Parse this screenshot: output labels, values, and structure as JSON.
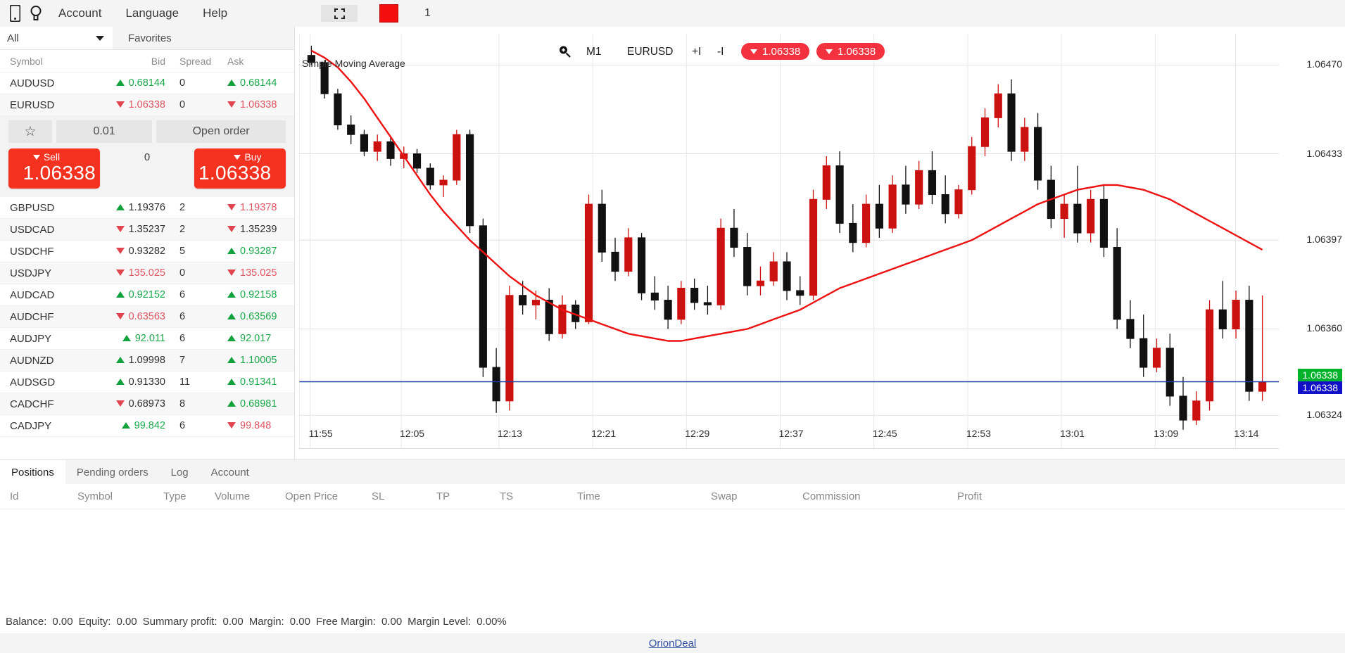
{
  "menu": {
    "icons": [
      {
        "name": "mobile-icon",
        "glyph": "▯"
      },
      {
        "name": "bulb-icon",
        "glyph": "◌"
      }
    ],
    "items": [
      {
        "label": "Account"
      },
      {
        "label": "Language"
      },
      {
        "label": "Help"
      }
    ]
  },
  "watchlist": {
    "filter_value": "All",
    "favorites_label": "Favorites",
    "columns": [
      "Symbol",
      "Bid",
      "Spread",
      "Ask"
    ],
    "rows": [
      {
        "symbol": "AUDUSD",
        "bid": "0.68144",
        "bid_dir": "up",
        "bid_color": "green",
        "spread": "0",
        "ask": "0.68144",
        "ask_dir": "up",
        "ask_color": "green"
      },
      {
        "symbol": "EURUSD",
        "bid": "1.06338",
        "bid_dir": "down",
        "bid_color": "red",
        "spread": "0",
        "ask": "1.06338",
        "ask_dir": "down",
        "ask_color": "red"
      },
      {
        "symbol": "GBPUSD",
        "bid": "1.19376",
        "bid_dir": "up",
        "bid_color": "dark",
        "spread": "2",
        "ask": "1.19378",
        "ask_dir": "down",
        "ask_color": "red"
      },
      {
        "symbol": "USDCAD",
        "bid": "1.35237",
        "bid_dir": "down",
        "bid_color": "dark",
        "spread": "2",
        "ask": "1.35239",
        "ask_dir": "down",
        "ask_color": "dark"
      },
      {
        "symbol": "USDCHF",
        "bid": "0.93282",
        "bid_dir": "down",
        "bid_color": "dark",
        "spread": "5",
        "ask": "0.93287",
        "ask_dir": "up",
        "ask_color": "green"
      },
      {
        "symbol": "USDJPY",
        "bid": "135.025",
        "bid_dir": "down",
        "bid_color": "red",
        "spread": "0",
        "ask": "135.025",
        "ask_dir": "down",
        "ask_color": "red"
      },
      {
        "symbol": "AUDCAD",
        "bid": "0.92152",
        "bid_dir": "up",
        "bid_color": "green",
        "spread": "6",
        "ask": "0.92158",
        "ask_dir": "up",
        "ask_color": "green"
      },
      {
        "symbol": "AUDCHF",
        "bid": "0.63563",
        "bid_dir": "down",
        "bid_color": "red",
        "spread": "6",
        "ask": "0.63569",
        "ask_dir": "up",
        "ask_color": "green"
      },
      {
        "symbol": "AUDJPY",
        "bid": "92.011",
        "bid_dir": "up",
        "bid_color": "green",
        "spread": "6",
        "ask": "92.017",
        "ask_dir": "up",
        "ask_color": "green"
      },
      {
        "symbol": "AUDNZD",
        "bid": "1.09998",
        "bid_dir": "up",
        "bid_color": "dark",
        "spread": "7",
        "ask": "1.10005",
        "ask_dir": "up",
        "ask_color": "green"
      },
      {
        "symbol": "AUDSGD",
        "bid": "0.91330",
        "bid_dir": "up",
        "bid_color": "dark",
        "spread": "11",
        "ask": "0.91341",
        "ask_dir": "up",
        "ask_color": "green"
      },
      {
        "symbol": "CADCHF",
        "bid": "0.68973",
        "bid_dir": "down",
        "bid_color": "dark",
        "spread": "8",
        "ask": "0.68981",
        "ask_dir": "up",
        "ask_color": "green"
      },
      {
        "symbol": "CADJPY",
        "bid": "99.842",
        "bid_dir": "up",
        "bid_color": "green",
        "spread": "6",
        "ask": "99.848",
        "ask_dir": "down",
        "ask_color": "red"
      }
    ],
    "order_panel": {
      "star_icon": "star-icon",
      "volume": "0.01",
      "open_order_label": "Open order",
      "sell_label": "Sell",
      "sell_price": "1.06338",
      "buy_label": "Buy",
      "buy_price": "1.06338",
      "spread": "0"
    }
  },
  "chart_toolbar": {
    "expand_icon": "fullscreen-icon",
    "color_swatch": "#f40e0e",
    "number": "1"
  },
  "chart_header": {
    "zoom_icon": "zoom-in-icon",
    "timeframe": "M1",
    "symbol": "EURUSD",
    "zoom_in_label": "+I",
    "zoom_out_label": "-I",
    "badge_bid": "1.06338",
    "badge_ask": "1.06338",
    "indicator_label": "Simple Moving Average"
  },
  "chart_data": {
    "type": "candlestick",
    "title": "EURUSD M1",
    "indicator": "Simple Moving Average",
    "indicator_color": "#ee1111",
    "up_color": "#111111",
    "down_color": "#cc1111",
    "grid": true,
    "ylabel": "",
    "xlabel": "",
    "ylim": [
      1.0631,
      1.06483
    ],
    "y_ticks": [
      "1.06470",
      "1.06433",
      "1.06397",
      "1.06360",
      "1.06324"
    ],
    "y_tick_values": [
      1.0647,
      1.06433,
      1.06397,
      1.0636,
      1.06324
    ],
    "current_price": "1.06338",
    "price_tag_bid": "1.06338",
    "price_tag_ask": "1.06338",
    "x_ticks": [
      "11:55",
      "12:05",
      "12:13",
      "12:21",
      "12:29",
      "12:37",
      "12:45",
      "12:53",
      "13:01",
      "13:09",
      "13:14"
    ],
    "candles": [
      {
        "o": 1.06474,
        "h": 1.06478,
        "l": 1.0647,
        "c": 1.06471,
        "dir": "down"
      },
      {
        "o": 1.06471,
        "h": 1.06472,
        "l": 1.06456,
        "c": 1.06458,
        "dir": "down"
      },
      {
        "o": 1.06458,
        "h": 1.0646,
        "l": 1.06443,
        "c": 1.06445,
        "dir": "down"
      },
      {
        "o": 1.06445,
        "h": 1.06449,
        "l": 1.06437,
        "c": 1.06441,
        "dir": "down"
      },
      {
        "o": 1.06441,
        "h": 1.06443,
        "l": 1.06432,
        "c": 1.06434,
        "dir": "down"
      },
      {
        "o": 1.06434,
        "h": 1.06441,
        "l": 1.0643,
        "c": 1.06438,
        "dir": "up"
      },
      {
        "o": 1.06438,
        "h": 1.0644,
        "l": 1.06428,
        "c": 1.06431,
        "dir": "down"
      },
      {
        "o": 1.06431,
        "h": 1.06436,
        "l": 1.06427,
        "c": 1.06433,
        "dir": "up"
      },
      {
        "o": 1.06433,
        "h": 1.06435,
        "l": 1.06425,
        "c": 1.06427,
        "dir": "down"
      },
      {
        "o": 1.06427,
        "h": 1.06429,
        "l": 1.06418,
        "c": 1.0642,
        "dir": "down"
      },
      {
        "o": 1.0642,
        "h": 1.06424,
        "l": 1.06415,
        "c": 1.06422,
        "dir": "up"
      },
      {
        "o": 1.06422,
        "h": 1.06443,
        "l": 1.0642,
        "c": 1.06441,
        "dir": "up"
      },
      {
        "o": 1.06441,
        "h": 1.06443,
        "l": 1.064,
        "c": 1.06403,
        "dir": "down"
      },
      {
        "o": 1.06403,
        "h": 1.06406,
        "l": 1.0634,
        "c": 1.06344,
        "dir": "down"
      },
      {
        "o": 1.06344,
        "h": 1.06352,
        "l": 1.06325,
        "c": 1.0633,
        "dir": "down"
      },
      {
        "o": 1.0633,
        "h": 1.06378,
        "l": 1.06326,
        "c": 1.06374,
        "dir": "up"
      },
      {
        "o": 1.06374,
        "h": 1.0638,
        "l": 1.06366,
        "c": 1.0637,
        "dir": "down"
      },
      {
        "o": 1.0637,
        "h": 1.06376,
        "l": 1.06364,
        "c": 1.06372,
        "dir": "up"
      },
      {
        "o": 1.06372,
        "h": 1.06377,
        "l": 1.06355,
        "c": 1.06358,
        "dir": "down"
      },
      {
        "o": 1.06358,
        "h": 1.06374,
        "l": 1.06356,
        "c": 1.0637,
        "dir": "up"
      },
      {
        "o": 1.0637,
        "h": 1.06372,
        "l": 1.0636,
        "c": 1.06363,
        "dir": "down"
      },
      {
        "o": 1.06363,
        "h": 1.06416,
        "l": 1.06362,
        "c": 1.06412,
        "dir": "up"
      },
      {
        "o": 1.06412,
        "h": 1.06418,
        "l": 1.06388,
        "c": 1.06392,
        "dir": "down"
      },
      {
        "o": 1.06392,
        "h": 1.06398,
        "l": 1.0638,
        "c": 1.06384,
        "dir": "down"
      },
      {
        "o": 1.06384,
        "h": 1.06402,
        "l": 1.06382,
        "c": 1.06398,
        "dir": "up"
      },
      {
        "o": 1.06398,
        "h": 1.064,
        "l": 1.06372,
        "c": 1.06375,
        "dir": "down"
      },
      {
        "o": 1.06375,
        "h": 1.06382,
        "l": 1.06368,
        "c": 1.06372,
        "dir": "down"
      },
      {
        "o": 1.06372,
        "h": 1.06378,
        "l": 1.0636,
        "c": 1.06364,
        "dir": "down"
      },
      {
        "o": 1.06364,
        "h": 1.0638,
        "l": 1.06362,
        "c": 1.06377,
        "dir": "up"
      },
      {
        "o": 1.06377,
        "h": 1.06381,
        "l": 1.06368,
        "c": 1.06371,
        "dir": "down"
      },
      {
        "o": 1.06371,
        "h": 1.06378,
        "l": 1.06366,
        "c": 1.0637,
        "dir": "down"
      },
      {
        "o": 1.0637,
        "h": 1.06406,
        "l": 1.06368,
        "c": 1.06402,
        "dir": "up"
      },
      {
        "o": 1.06402,
        "h": 1.0641,
        "l": 1.0639,
        "c": 1.06394,
        "dir": "down"
      },
      {
        "o": 1.06394,
        "h": 1.064,
        "l": 1.06374,
        "c": 1.06378,
        "dir": "down"
      },
      {
        "o": 1.06378,
        "h": 1.06386,
        "l": 1.06374,
        "c": 1.0638,
        "dir": "up"
      },
      {
        "o": 1.0638,
        "h": 1.06392,
        "l": 1.06378,
        "c": 1.06388,
        "dir": "up"
      },
      {
        "o": 1.06388,
        "h": 1.06392,
        "l": 1.06372,
        "c": 1.06376,
        "dir": "down"
      },
      {
        "o": 1.06376,
        "h": 1.06382,
        "l": 1.0637,
        "c": 1.06374,
        "dir": "down"
      },
      {
        "o": 1.06374,
        "h": 1.06418,
        "l": 1.06372,
        "c": 1.06414,
        "dir": "up"
      },
      {
        "o": 1.06414,
        "h": 1.06432,
        "l": 1.0641,
        "c": 1.06428,
        "dir": "up"
      },
      {
        "o": 1.06428,
        "h": 1.06434,
        "l": 1.064,
        "c": 1.06404,
        "dir": "down"
      },
      {
        "o": 1.06404,
        "h": 1.06412,
        "l": 1.06392,
        "c": 1.06396,
        "dir": "down"
      },
      {
        "o": 1.06396,
        "h": 1.06416,
        "l": 1.06394,
        "c": 1.06412,
        "dir": "up"
      },
      {
        "o": 1.06412,
        "h": 1.0642,
        "l": 1.06398,
        "c": 1.06402,
        "dir": "down"
      },
      {
        "o": 1.06402,
        "h": 1.06424,
        "l": 1.064,
        "c": 1.0642,
        "dir": "up"
      },
      {
        "o": 1.0642,
        "h": 1.06428,
        "l": 1.06408,
        "c": 1.06412,
        "dir": "down"
      },
      {
        "o": 1.06412,
        "h": 1.0643,
        "l": 1.0641,
        "c": 1.06426,
        "dir": "up"
      },
      {
        "o": 1.06426,
        "h": 1.06434,
        "l": 1.06412,
        "c": 1.06416,
        "dir": "down"
      },
      {
        "o": 1.06416,
        "h": 1.06424,
        "l": 1.06404,
        "c": 1.06408,
        "dir": "down"
      },
      {
        "o": 1.06408,
        "h": 1.0642,
        "l": 1.06406,
        "c": 1.06418,
        "dir": "up"
      },
      {
        "o": 1.06418,
        "h": 1.0644,
        "l": 1.06416,
        "c": 1.06436,
        "dir": "up"
      },
      {
        "o": 1.06436,
        "h": 1.06452,
        "l": 1.06432,
        "c": 1.06448,
        "dir": "up"
      },
      {
        "o": 1.06448,
        "h": 1.06462,
        "l": 1.06444,
        "c": 1.06458,
        "dir": "up"
      },
      {
        "o": 1.06458,
        "h": 1.06464,
        "l": 1.0643,
        "c": 1.06434,
        "dir": "down"
      },
      {
        "o": 1.06434,
        "h": 1.06448,
        "l": 1.0643,
        "c": 1.06444,
        "dir": "up"
      },
      {
        "o": 1.06444,
        "h": 1.0645,
        "l": 1.06418,
        "c": 1.06422,
        "dir": "down"
      },
      {
        "o": 1.06422,
        "h": 1.06428,
        "l": 1.06402,
        "c": 1.06406,
        "dir": "down"
      },
      {
        "o": 1.06406,
        "h": 1.06416,
        "l": 1.06398,
        "c": 1.06412,
        "dir": "up"
      },
      {
        "o": 1.06412,
        "h": 1.06428,
        "l": 1.06396,
        "c": 1.064,
        "dir": "down"
      },
      {
        "o": 1.064,
        "h": 1.06418,
        "l": 1.06396,
        "c": 1.06414,
        "dir": "up"
      },
      {
        "o": 1.06414,
        "h": 1.0642,
        "l": 1.0639,
        "c": 1.06394,
        "dir": "down"
      },
      {
        "o": 1.06394,
        "h": 1.06402,
        "l": 1.0636,
        "c": 1.06364,
        "dir": "down"
      },
      {
        "o": 1.06364,
        "h": 1.06372,
        "l": 1.06352,
        "c": 1.06356,
        "dir": "down"
      },
      {
        "o": 1.06356,
        "h": 1.06366,
        "l": 1.0634,
        "c": 1.06344,
        "dir": "down"
      },
      {
        "o": 1.06344,
        "h": 1.06356,
        "l": 1.06342,
        "c": 1.06352,
        "dir": "up"
      },
      {
        "o": 1.06352,
        "h": 1.06358,
        "l": 1.06328,
        "c": 1.06332,
        "dir": "down"
      },
      {
        "o": 1.06332,
        "h": 1.0634,
        "l": 1.06318,
        "c": 1.06322,
        "dir": "down"
      },
      {
        "o": 1.06322,
        "h": 1.06334,
        "l": 1.0632,
        "c": 1.0633,
        "dir": "up"
      },
      {
        "o": 1.0633,
        "h": 1.06372,
        "l": 1.06326,
        "c": 1.06368,
        "dir": "up"
      },
      {
        "o": 1.06368,
        "h": 1.0638,
        "l": 1.06356,
        "c": 1.0636,
        "dir": "down"
      },
      {
        "o": 1.0636,
        "h": 1.06376,
        "l": 1.06356,
        "c": 1.06372,
        "dir": "up"
      },
      {
        "o": 1.06372,
        "h": 1.06378,
        "l": 1.0633,
        "c": 1.06334,
        "dir": "down"
      },
      {
        "o": 1.06334,
        "h": 1.06374,
        "l": 1.0633,
        "c": 1.06338,
        "dir": "up"
      }
    ],
    "sma_values": [
      1.06476,
      1.06473,
      1.06469,
      1.06463,
      1.06456,
      1.06448,
      1.0644,
      1.06432,
      1.06424,
      1.06416,
      1.06409,
      1.06403,
      1.06397,
      1.06392,
      1.06387,
      1.06382,
      1.06378,
      1.06374,
      1.06371,
      1.06368,
      1.06366,
      1.06364,
      1.06362,
      1.0636,
      1.06358,
      1.06357,
      1.06356,
      1.06355,
      1.06355,
      1.06356,
      1.06357,
      1.06358,
      1.06359,
      1.0636,
      1.06362,
      1.06364,
      1.06366,
      1.06368,
      1.06371,
      1.06374,
      1.06377,
      1.06379,
      1.06381,
      1.06383,
      1.06385,
      1.06387,
      1.06389,
      1.06391,
      1.06393,
      1.06395,
      1.06397,
      1.064,
      1.06403,
      1.06406,
      1.06409,
      1.06412,
      1.06414,
      1.06416,
      1.06418,
      1.06419,
      1.0642,
      1.0642,
      1.06419,
      1.06418,
      1.06416,
      1.06414,
      1.06411,
      1.06408,
      1.06405,
      1.06402,
      1.06399,
      1.06396,
      1.06393
    ]
  },
  "bottom": {
    "tabs": [
      {
        "label": "Positions",
        "active": true
      },
      {
        "label": "Pending orders",
        "active": false
      },
      {
        "label": "Log",
        "active": false
      },
      {
        "label": "Account",
        "active": false
      }
    ],
    "columns": [
      "Id",
      "Symbol",
      "Type",
      "Volume",
      "Open Price",
      "SL",
      "TP",
      "TS",
      "Time",
      "Swap",
      "Commission",
      "Profit"
    ],
    "rows": []
  },
  "status": {
    "balance_label": "Balance:",
    "balance": "0.00",
    "equity_label": "Equity:",
    "equity": "0.00",
    "summary_label": "Summary profit:",
    "summary": "0.00",
    "margin_label": "Margin:",
    "margin": "0.00",
    "free_margin_label": "Free Margin:",
    "free_margin": "0.00",
    "margin_level_label": "Margin Level:",
    "margin_level": "0.00%"
  },
  "footer": {
    "link": "OrionDeal"
  }
}
